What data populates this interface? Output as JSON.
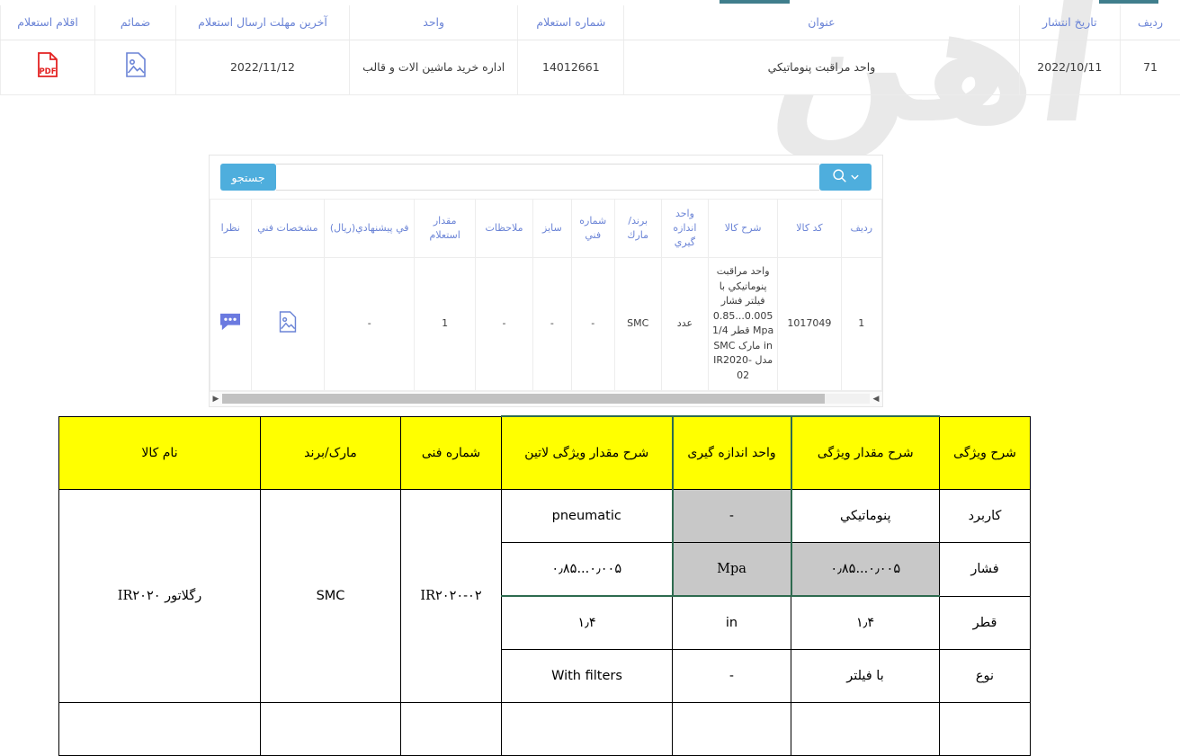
{
  "watermark_text": "آهن",
  "top_bar": {
    "tabs_visible": 3
  },
  "inquiry_table": {
    "headers": {
      "row_no": "ردیف",
      "publish_date": "تاریخ انتشار",
      "title": "عنوان",
      "inquiry_number": "شماره استعلام",
      "unit": "واحد",
      "deadline": "آخرین مهلت ارسال استعلام",
      "attachments": "ضمائم",
      "inquiry_items": "اقلام استعلام"
    },
    "rows": [
      {
        "row_no": "71",
        "publish_date": "2022/10/11",
        "title": "واحد مراقبت پنوماتيکي",
        "inquiry_number": "14012661",
        "unit": "اداره خرید ماشین الات و قالب",
        "deadline": "2022/11/12",
        "attachments_icon": "image-file-icon",
        "items_icon": "pdf-file-icon"
      }
    ]
  },
  "search": {
    "button_label": "جستجو",
    "input_value": "",
    "input_placeholder": "",
    "magnifier_icon": "search-icon",
    "chevron_icon": "chevron-down-icon"
  },
  "items_table": {
    "headers": [
      "ردیف",
      "کد کالا",
      "شرح کالا",
      "واحد اندازه گيري",
      "برند/ مارك",
      "شماره فني",
      "سایز",
      "ملاحظات",
      "مقدار استعلام",
      "في پیشنهادي(ریال)",
      "مشخصات فني",
      "نظرا"
    ],
    "rows": [
      {
        "row_no": "1",
        "code": "1017049",
        "description": "واحد مراقبت پنوماتيکي با فیلتر فشار 0.005...0.85 Mpa قطر 1/4 in مارک SMC مدل IR2020-02",
        "measure_unit": "عدد",
        "brand": "SMC",
        "tech_number": "-",
        "size": "-",
        "notes": "-",
        "quantity": "1",
        "unit_price": "-",
        "tech_spec_icon": "image-file-icon",
        "comments_icon": "comment-bubble-icon"
      }
    ],
    "scrollbar": {
      "left_arrow": "◀",
      "right_arrow": "▶",
      "thumb_percent": 93
    }
  },
  "spec_table": {
    "headers": [
      "نام کالا",
      "مارک/برند",
      "شماره فنی",
      "شرح مقدار ویژگی لاتین",
      "واحد اندازه گیری",
      "شرح مقدار ویژگی",
      "شرح ویژگی"
    ],
    "merged": {
      "product_name": "رگلاتور IR۲۰۲۰",
      "brand": "SMC",
      "tech_number": "IR۲۰۲۰-۰۲"
    },
    "rows": [
      {
        "latin_value": "pneumatic",
        "measure_unit": "-",
        "value": "پنوماتيکي",
        "feature": "کاربرد",
        "unit_grey": true,
        "value_grey": false
      },
      {
        "latin_value": "۰٫۰۰۵...۰٫۸۵",
        "measure_unit": "Mpa",
        "value": "۰٫۰۰۵...۰٫۸۵",
        "feature": "فشار",
        "unit_grey": true,
        "value_grey": true
      },
      {
        "latin_value": "۱٫۴",
        "measure_unit": "in",
        "value": "۱٫۴",
        "feature": "قطر",
        "unit_grey": false,
        "value_grey": false
      },
      {
        "latin_value": "With filters",
        "measure_unit": "-",
        "value": "با فیلتر",
        "feature": "نوع",
        "unit_grey": false,
        "value_grey": false
      }
    ]
  }
}
